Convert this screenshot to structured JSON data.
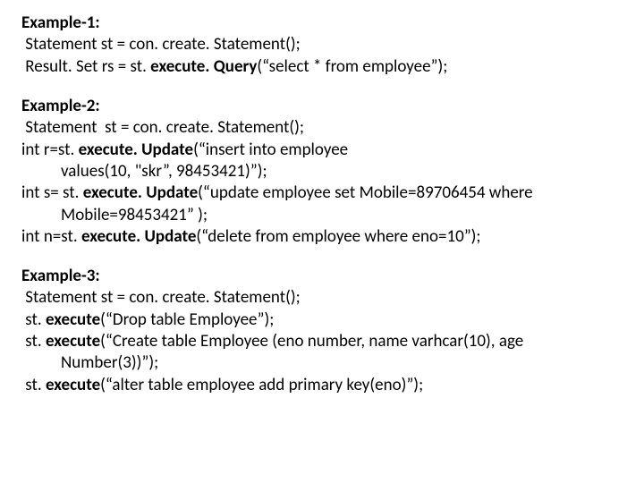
{
  "ex1": {
    "title": "Example-1:",
    "l1": " Statement st = con. create. Statement();",
    "l2a": " Result. Set rs = st. ",
    "l2b": "execute. Query",
    "l2c": "(“select * from employee”);"
  },
  "ex2": {
    "title": "Example-2:",
    "l1": " Statement  st = con. create. Statement();",
    "l2a": "int r=st. ",
    "l2b": "execute. Update",
    "l2c": "(“insert into employee",
    "l2d": "values(10, \"skr”, 98453421)”);",
    "l3a": "int s= st. ",
    "l3b": "execute. Update",
    "l3c": "(“update employee set Mobile=89706454 where",
    "l3d": "Mobile=98453421” );",
    "l4a": "int n=st. ",
    "l4b": "execute. Update",
    "l4c": "(“delete from employee where eno=10”);"
  },
  "ex3": {
    "title": "Example-3:",
    "l1": " Statement st = con. create. Statement();",
    "l2a": " st. ",
    "l2b": "execute",
    "l2c": "(“Drop table Employee”);",
    "l3a": " st. ",
    "l3b": "execute",
    "l3c": "(“Create table Employee (eno number, name varhcar(10), age",
    "l3d": "Number(3))”);",
    "l4a": " st. ",
    "l4b": "execute",
    "l4c": "(“alter table employee add primary key(eno)”);"
  }
}
